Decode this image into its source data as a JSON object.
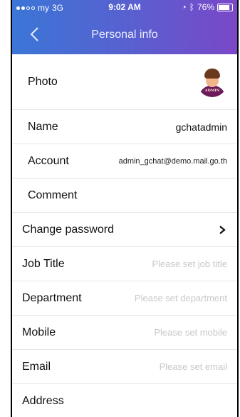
{
  "status": {
    "carrier": "my",
    "network": "3G",
    "time": "9:02 AM",
    "battery": "76%",
    "battery_level": 0.76
  },
  "nav": {
    "title": "Personal info",
    "back_icon": "chevron-left-icon"
  },
  "rows": {
    "photo": {
      "label": "Photo",
      "avatar_text": "ADMIN"
    },
    "name": {
      "label": "Name",
      "value": "gchatadmin"
    },
    "account": {
      "label": "Account",
      "value": "admin_gchat@demo.mail.go.th"
    },
    "comment": {
      "label": "Comment",
      "value": ""
    },
    "change_password": {
      "label": "Change password"
    },
    "job_title": {
      "label": "Job Title",
      "placeholder": "Please set job title"
    },
    "department": {
      "label": "Department",
      "placeholder": "Please set department"
    },
    "mobile": {
      "label": "Mobile",
      "placeholder": "Please set mobile"
    },
    "email": {
      "label": "Email",
      "placeholder": "Please set email"
    },
    "address": {
      "label": "Address"
    }
  },
  "colors": {
    "header_gradient": [
      "#3b76d6",
      "#7a47c8"
    ],
    "placeholder": "#c8c8cc"
  }
}
